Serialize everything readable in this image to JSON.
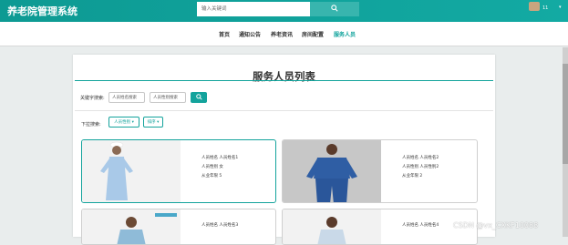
{
  "app": {
    "title": "养老院管理系统"
  },
  "header": {
    "search_placeholder": "输入关键词",
    "search_icon": "search-icon",
    "username": "11",
    "user_menu_icon": "chevron-down-icon"
  },
  "nav": {
    "items": [
      {
        "label": "首页",
        "active": false
      },
      {
        "label": "通知公告",
        "active": false
      },
      {
        "label": "养老资讯",
        "active": false
      },
      {
        "label": "房间配置",
        "active": false
      },
      {
        "label": "服务人员",
        "active": true
      }
    ]
  },
  "page": {
    "title": "服务人员列表"
  },
  "keyword_search": {
    "label": "关键字搜索:",
    "name_placeholder": "人员姓名搜索",
    "number_placeholder": "人员性别搜索",
    "button_icon": "search-icon"
  },
  "dropdown_search": {
    "label": "下拉搜索:",
    "gender_button": "人员性别 ▾",
    "sort_button": "排序 ▾"
  },
  "cards": [
    {
      "line1": "人员姓名  人员姓名1",
      "line2": "人员性别  女",
      "line3": "从业年限  5"
    },
    {
      "line1": "人员姓名  人员姓名2",
      "line2": "人员性别  人员性别2",
      "line3": "从业年限  2"
    },
    {
      "line1": "人员姓名  人员姓名3"
    },
    {
      "line1": "人员姓名  人员姓名4"
    }
  ],
  "watermark": "CSDN @vx_CXKF10088",
  "colors": {
    "brand": "#10a39c",
    "header_bg": "#0d9a93"
  }
}
